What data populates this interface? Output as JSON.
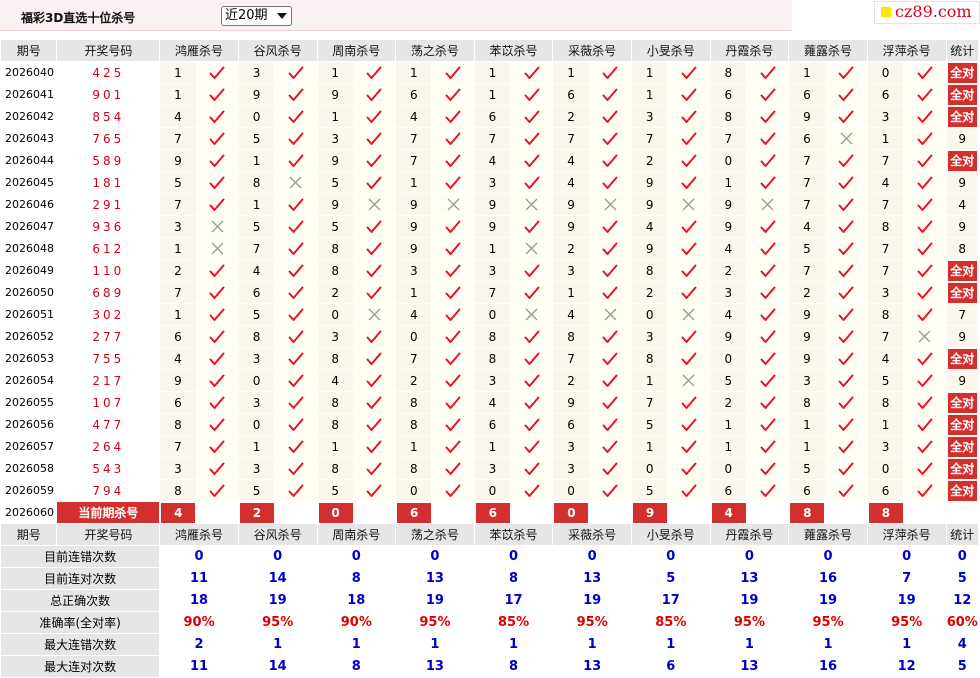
{
  "header": {
    "title": "福彩3D直选十位杀号",
    "period_selected": "近20期",
    "site_logo": "cz89.com"
  },
  "columns": {
    "issue": "期号",
    "winning": "开奖号码",
    "total": "统计",
    "experts": [
      "鸿雁杀号",
      "谷风杀号",
      "周南杀号",
      "荡之杀号",
      "苯苡杀号",
      "采薇杀号",
      "小旻杀号",
      "丹霞杀号",
      "蕹露杀号",
      "浮萍杀号"
    ]
  },
  "rows": [
    {
      "issue": "2026040",
      "win": "425",
      "kills": [
        1,
        3,
        1,
        1,
        1,
        1,
        1,
        8,
        1,
        0
      ],
      "hits": [
        1,
        1,
        1,
        1,
        1,
        1,
        1,
        1,
        1,
        1
      ],
      "total": "全对"
    },
    {
      "issue": "2026041",
      "win": "901",
      "kills": [
        1,
        9,
        9,
        6,
        1,
        6,
        1,
        6,
        6,
        6
      ],
      "hits": [
        1,
        1,
        1,
        1,
        1,
        1,
        1,
        1,
        1,
        1
      ],
      "total": "全对"
    },
    {
      "issue": "2026042",
      "win": "854",
      "kills": [
        4,
        0,
        1,
        4,
        6,
        2,
        3,
        8,
        9,
        3
      ],
      "hits": [
        1,
        1,
        1,
        1,
        1,
        1,
        1,
        1,
        1,
        1
      ],
      "total": "全对"
    },
    {
      "issue": "2026043",
      "win": "765",
      "kills": [
        7,
        5,
        3,
        7,
        7,
        7,
        7,
        7,
        6,
        1
      ],
      "hits": [
        1,
        1,
        1,
        1,
        1,
        1,
        1,
        1,
        0,
        1
      ],
      "total": "9"
    },
    {
      "issue": "2026044",
      "win": "589",
      "kills": [
        9,
        1,
        9,
        7,
        4,
        4,
        2,
        0,
        7,
        7
      ],
      "hits": [
        1,
        1,
        1,
        1,
        1,
        1,
        1,
        1,
        1,
        1
      ],
      "total": "全对"
    },
    {
      "issue": "2026045",
      "win": "181",
      "kills": [
        5,
        8,
        5,
        1,
        3,
        4,
        9,
        1,
        7,
        4
      ],
      "hits": [
        1,
        0,
        1,
        1,
        1,
        1,
        1,
        1,
        1,
        1
      ],
      "total": "9"
    },
    {
      "issue": "2026046",
      "win": "291",
      "kills": [
        7,
        1,
        9,
        9,
        9,
        9,
        9,
        9,
        7,
        7
      ],
      "hits": [
        1,
        1,
        0,
        0,
        0,
        0,
        0,
        0,
        1,
        1
      ],
      "total": "4"
    },
    {
      "issue": "2026047",
      "win": "936",
      "kills": [
        3,
        5,
        5,
        9,
        9,
        9,
        4,
        9,
        4,
        8
      ],
      "hits": [
        0,
        1,
        1,
        1,
        1,
        1,
        1,
        1,
        1,
        1
      ],
      "total": "9"
    },
    {
      "issue": "2026048",
      "win": "612",
      "kills": [
        1,
        7,
        8,
        9,
        1,
        2,
        9,
        4,
        5,
        7
      ],
      "hits": [
        0,
        1,
        1,
        1,
        0,
        1,
        1,
        1,
        1,
        1
      ],
      "total": "8"
    },
    {
      "issue": "2026049",
      "win": "110",
      "kills": [
        2,
        4,
        8,
        3,
        3,
        3,
        8,
        2,
        7,
        7
      ],
      "hits": [
        1,
        1,
        1,
        1,
        1,
        1,
        1,
        1,
        1,
        1
      ],
      "total": "全对"
    },
    {
      "issue": "2026050",
      "win": "689",
      "kills": [
        7,
        6,
        2,
        1,
        7,
        1,
        2,
        3,
        2,
        3
      ],
      "hits": [
        1,
        1,
        1,
        1,
        1,
        1,
        1,
        1,
        1,
        1
      ],
      "total": "全对"
    },
    {
      "issue": "2026051",
      "win": "302",
      "kills": [
        1,
        5,
        0,
        4,
        0,
        4,
        0,
        4,
        9,
        8
      ],
      "hits": [
        1,
        1,
        0,
        1,
        0,
        0,
        0,
        1,
        1,
        1
      ],
      "total": "7"
    },
    {
      "issue": "2026052",
      "win": "277",
      "kills": [
        6,
        8,
        3,
        0,
        8,
        8,
        3,
        9,
        9,
        7
      ],
      "hits": [
        1,
        1,
        1,
        1,
        1,
        1,
        1,
        1,
        1,
        0
      ],
      "total": "9"
    },
    {
      "issue": "2026053",
      "win": "755",
      "kills": [
        4,
        3,
        8,
        7,
        8,
        7,
        8,
        0,
        9,
        4
      ],
      "hits": [
        1,
        1,
        1,
        1,
        1,
        1,
        1,
        1,
        1,
        1
      ],
      "total": "全对"
    },
    {
      "issue": "2026054",
      "win": "217",
      "kills": [
        9,
        0,
        4,
        2,
        3,
        2,
        1,
        5,
        3,
        5
      ],
      "hits": [
        1,
        1,
        1,
        1,
        1,
        1,
        0,
        1,
        1,
        1
      ],
      "total": "9"
    },
    {
      "issue": "2026055",
      "win": "107",
      "kills": [
        6,
        3,
        8,
        8,
        4,
        9,
        7,
        2,
        8,
        8
      ],
      "hits": [
        1,
        1,
        1,
        1,
        1,
        1,
        1,
        1,
        1,
        1
      ],
      "total": "全对"
    },
    {
      "issue": "2026056",
      "win": "477",
      "kills": [
        8,
        0,
        8,
        8,
        6,
        6,
        5,
        1,
        1,
        1
      ],
      "hits": [
        1,
        1,
        1,
        1,
        1,
        1,
        1,
        1,
        1,
        1
      ],
      "total": "全对"
    },
    {
      "issue": "2026057",
      "win": "264",
      "kills": [
        7,
        1,
        1,
        1,
        1,
        3,
        1,
        1,
        1,
        3
      ],
      "hits": [
        1,
        1,
        1,
        1,
        1,
        1,
        1,
        1,
        1,
        1
      ],
      "total": "全对"
    },
    {
      "issue": "2026058",
      "win": "543",
      "kills": [
        3,
        3,
        8,
        8,
        3,
        3,
        0,
        0,
        5,
        0
      ],
      "hits": [
        1,
        1,
        1,
        1,
        1,
        1,
        1,
        1,
        1,
        1
      ],
      "total": "全对"
    },
    {
      "issue": "2026059",
      "win": "794",
      "kills": [
        8,
        5,
        5,
        0,
        0,
        0,
        5,
        6,
        6,
        6
      ],
      "hits": [
        1,
        1,
        1,
        1,
        1,
        1,
        1,
        1,
        1,
        1
      ],
      "total": "全对"
    }
  ],
  "current": {
    "issue": "2026060",
    "label": "当前期杀号",
    "kills": [
      4,
      2,
      0,
      6,
      6,
      0,
      9,
      4,
      8,
      8
    ]
  },
  "stats": [
    {
      "label": "目前连错次数",
      "values": [
        "0",
        "0",
        "0",
        "0",
        "0",
        "0",
        "0",
        "0",
        "0",
        "0"
      ],
      "total": "0"
    },
    {
      "label": "目前连对次数",
      "values": [
        "11",
        "14",
        "8",
        "13",
        "8",
        "13",
        "5",
        "13",
        "16",
        "7"
      ],
      "total": "5"
    },
    {
      "label": "总正确次数",
      "values": [
        "18",
        "19",
        "18",
        "19",
        "17",
        "19",
        "17",
        "19",
        "19",
        "19"
      ],
      "total": "12"
    },
    {
      "label": "准确率(全对率)",
      "values": [
        "90%",
        "95%",
        "90%",
        "95%",
        "85%",
        "95%",
        "85%",
        "95%",
        "95%",
        "95%"
      ],
      "total": "60%",
      "pct": true
    },
    {
      "label": "最大连错次数",
      "values": [
        "2",
        "1",
        "1",
        "1",
        "1",
        "1",
        "1",
        "1",
        "1",
        "1"
      ],
      "total": "4"
    },
    {
      "label": "最大连对次数",
      "values": [
        "11",
        "14",
        "8",
        "13",
        "8",
        "13",
        "6",
        "13",
        "16",
        "12"
      ],
      "total": "5"
    }
  ],
  "icons": {
    "hit": "check-icon",
    "miss": "cross-icon"
  },
  "colors": {
    "accent": "#d32f2f",
    "check": "#e8112d",
    "cross": "#999999",
    "stat_blue": "#0000cc",
    "pct_red": "#e00000"
  }
}
